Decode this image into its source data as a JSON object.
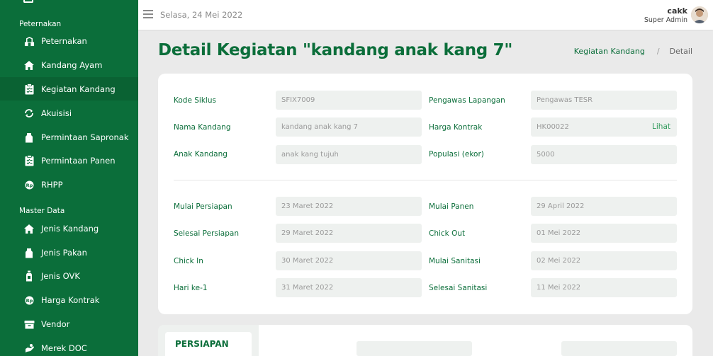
{
  "sidebar": {
    "section_peternakan": "Peternakan",
    "section_master": "Master Data",
    "items": [
      {
        "label": "Peternakan",
        "icon": "farm-icon"
      },
      {
        "label": "Kandang Ayam",
        "icon": "home-icon"
      },
      {
        "label": "Kegiatan Kandang",
        "icon": "clipboard-icon",
        "active": true
      },
      {
        "label": "Akuisisi",
        "icon": "refresh-icon"
      },
      {
        "label": "Permintaan Sapronak",
        "icon": "bag-icon"
      },
      {
        "label": "Permintaan Panen",
        "icon": "clipboard-icon"
      },
      {
        "label": "RHPP",
        "icon": "rupiah-icon"
      }
    ],
    "master_items": [
      {
        "label": "Jenis Kandang",
        "icon": "home-icon"
      },
      {
        "label": "Jenis Pakan",
        "icon": "bag-icon"
      },
      {
        "label": "Jenis OVK",
        "icon": "bottle-icon"
      },
      {
        "label": "Harga Kontrak",
        "icon": "rupiah-icon"
      },
      {
        "label": "Vendor",
        "icon": "box-icon"
      },
      {
        "label": "Merek DOC",
        "icon": "hand-icon"
      }
    ]
  },
  "topbar": {
    "date": "Selasa, 24 Mei 2022",
    "user_name": "cakk",
    "user_role": "Super Admin"
  },
  "header": {
    "title": "Detail Kegiatan \"kandang anak kang 7\"",
    "breadcrumb_link": "Kegiatan Kandang",
    "breadcrumb_sep": "/",
    "breadcrumb_current": "Detail"
  },
  "form": {
    "kode_siklus_label": "Kode Siklus",
    "kode_siklus": "SFIX7009",
    "pengawas_label": "Pengawas Lapangan",
    "pengawas": "Pengawas TESR",
    "nama_kandang_label": "Nama Kandang",
    "nama_kandang": "kandang anak kang 7",
    "harga_kontrak_label": "Harga Kontrak",
    "harga_kontrak": "HK00022",
    "lihat": "Lihat",
    "anak_kandang_label": "Anak Kandang",
    "anak_kandang": "anak kang tujuh",
    "populasi_label": "Populasi (ekor)",
    "populasi": "5000",
    "mulai_persiapan_label": "Mulai Persiapan",
    "mulai_persiapan": "23 Maret 2022",
    "mulai_panen_label": "Mulai Panen",
    "mulai_panen": "29 April 2022",
    "selesai_persiapan_label": "Selesai Persiapan",
    "selesai_persiapan": "29 Maret 2022",
    "chick_out_label": "Chick Out",
    "chick_out": "01 Mei 2022",
    "chick_in_label": "Chick In",
    "chick_in": "30 Maret 2022",
    "mulai_sanitasi_label": "Mulai Sanitasi",
    "mulai_sanitasi": "02 Mei 2022",
    "hari_ke_label": "Hari ke-1",
    "hari_ke": "31 Maret 2022",
    "selesai_sanitasi_label": "Selesai Sanitasi",
    "selesai_sanitasi": "11 Mei 2022"
  },
  "tabs": {
    "active": "PERSIAPAN"
  },
  "colors": {
    "sidebar": "#0b6e3a",
    "accent": "#0b6e3a",
    "link": "#2e9a5a"
  }
}
